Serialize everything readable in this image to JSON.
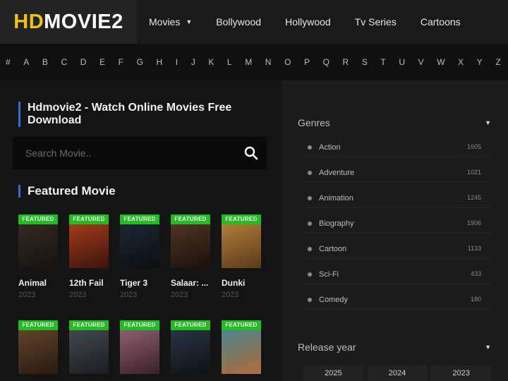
{
  "logo": {
    "part1": "HD",
    "part2": "MOVIE2"
  },
  "nav": [
    {
      "label": "Movies",
      "caret": "▼"
    },
    {
      "label": "Bollywood"
    },
    {
      "label": "Hollywood"
    },
    {
      "label": "Tv Series"
    },
    {
      "label": "Cartoons"
    }
  ],
  "alphabet": [
    "#",
    "A",
    "B",
    "C",
    "D",
    "E",
    "F",
    "G",
    "H",
    "I",
    "J",
    "K",
    "L",
    "M",
    "N",
    "O",
    "P",
    "Q",
    "R",
    "S",
    "T",
    "U",
    "V",
    "W",
    "X",
    "Y",
    "Z"
  ],
  "main": {
    "title": "Hdmovie2 - Watch Online Movies Free Download",
    "search_placeholder": "Search Movie..",
    "featured_heading": "Featured Movie",
    "badge_label": "FEATURED",
    "movies": [
      {
        "title": "Animal",
        "year": "2023",
        "poster_colors": [
          "#3a2e22",
          "#151210"
        ]
      },
      {
        "title": "12th Fail",
        "year": "2023",
        "poster_colors": [
          "#b5421f",
          "#3a140b"
        ]
      },
      {
        "title": "Tiger 3",
        "year": "2023",
        "poster_colors": [
          "#1f2a36",
          "#0b0f14"
        ]
      },
      {
        "title": "Salaar: ...",
        "year": "2023",
        "poster_colors": [
          "#5a3a28",
          "#1a100b"
        ]
      },
      {
        "title": "Dunki",
        "year": "2023",
        "poster_colors": [
          "#c0883e",
          "#5a3a1a"
        ]
      },
      {
        "title": "",
        "year": "",
        "poster_colors": [
          "#6b4a2f",
          "#2a1a10"
        ]
      },
      {
        "title": "",
        "year": "",
        "poster_colors": [
          "#4a5058",
          "#1a1d20"
        ]
      },
      {
        "title": "",
        "year": "",
        "poster_colors": [
          "#9a6a7a",
          "#3a202a"
        ]
      },
      {
        "title": "",
        "year": "",
        "poster_colors": [
          "#2e3a4a",
          "#0e1218"
        ]
      },
      {
        "title": "",
        "year": "",
        "poster_colors": [
          "#3a8a9a",
          "#b06a3a"
        ]
      }
    ]
  },
  "sidebar": {
    "genres_heading": "Genres",
    "genres": [
      {
        "name": "Action",
        "count": "1605"
      },
      {
        "name": "Adventure",
        "count": "1021"
      },
      {
        "name": "Animation",
        "count": "1245"
      },
      {
        "name": "Biography",
        "count": "1906"
      },
      {
        "name": "Cartoon",
        "count": "1133"
      },
      {
        "name": "Sci-Fi",
        "count": "433"
      },
      {
        "name": "Comedy",
        "count": "180"
      }
    ],
    "release_heading": "Release year",
    "years": [
      "2025",
      "2024",
      "2023"
    ]
  },
  "colors": {
    "brand_yellow": "#f2c40c",
    "badge_green": "#1fbf1f",
    "accent_blue": "#2d6fd2"
  }
}
